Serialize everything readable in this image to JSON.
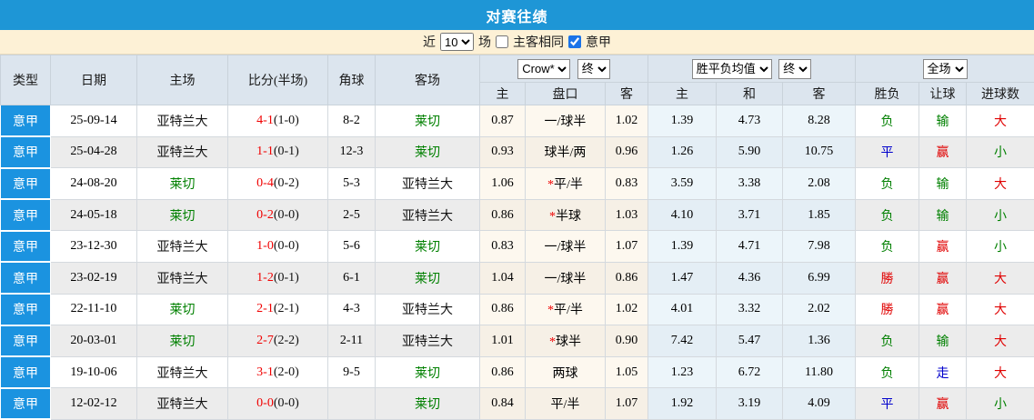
{
  "title": "对赛往绩",
  "colors": {
    "title_bar": "#1e96d6",
    "filter_bar": "#fdf1d6",
    "header_bg": "#dce5ee",
    "league_cell": "#1b93e0",
    "odds_col_bg": "#fdf8ef",
    "avg_col_bg": "#ecf5fa",
    "win_red": "#e00000",
    "lose_green": "#008000",
    "draw_blue": "#0000cc"
  },
  "filter": {
    "near_label": "近",
    "near_value": "10",
    "games_label": "场",
    "same_venue_label": "主客相同",
    "same_venue_checked": false,
    "league_label": "意甲",
    "league_checked": true
  },
  "table": {
    "selects": {
      "bookmaker": "Crow*",
      "bookmaker_time": "终",
      "avg": "胜平负均值",
      "avg_time": "终",
      "period": "全场"
    },
    "columns": {
      "type": "类型",
      "date": "日期",
      "home": "主场",
      "score": "比分(半场)",
      "corner": "角球",
      "away": "客场",
      "odds_home": "主",
      "handicap": "盘口",
      "odds_away": "客",
      "avg_home": "主",
      "avg_draw": "和",
      "avg_away": "客",
      "result": "胜负",
      "handicap_result": "让球",
      "goals": "进球数"
    },
    "rows": [
      {
        "type": "意甲",
        "date": "25-09-14",
        "home": "亚特兰大",
        "home_color": "black",
        "score": "4-1",
        "half": "(1-0)",
        "corner": "8-2",
        "away": "莱切",
        "away_color": "green",
        "odds_home": "0.87",
        "star": "",
        "handicap": "一/球半",
        "odds_away": "1.02",
        "avg_home": "1.39",
        "avg_draw": "4.73",
        "avg_away": "8.28",
        "result": "负",
        "result_color": "green",
        "handicap_result": "输",
        "handicap_result_color": "green",
        "goals": "大",
        "goals_color": "red"
      },
      {
        "type": "意甲",
        "date": "25-04-28",
        "home": "亚特兰大",
        "home_color": "black",
        "score": "1-1",
        "half": "(0-1)",
        "corner": "12-3",
        "away": "莱切",
        "away_color": "green",
        "odds_home": "0.93",
        "star": "",
        "handicap": "球半/两",
        "odds_away": "0.96",
        "avg_home": "1.26",
        "avg_draw": "5.90",
        "avg_away": "10.75",
        "result": "平",
        "result_color": "blue",
        "handicap_result": "赢",
        "handicap_result_color": "red",
        "goals": "小",
        "goals_color": "green"
      },
      {
        "type": "意甲",
        "date": "24-08-20",
        "home": "莱切",
        "home_color": "green",
        "score": "0-4",
        "half": "(0-2)",
        "corner": "5-3",
        "away": "亚特兰大",
        "away_color": "black",
        "odds_home": "1.06",
        "star": "*",
        "handicap": "平/半",
        "odds_away": "0.83",
        "avg_home": "3.59",
        "avg_draw": "3.38",
        "avg_away": "2.08",
        "result": "负",
        "result_color": "green",
        "handicap_result": "输",
        "handicap_result_color": "green",
        "goals": "大",
        "goals_color": "red"
      },
      {
        "type": "意甲",
        "date": "24-05-18",
        "home": "莱切",
        "home_color": "green",
        "score": "0-2",
        "half": "(0-0)",
        "corner": "2-5",
        "away": "亚特兰大",
        "away_color": "black",
        "odds_home": "0.86",
        "star": "*",
        "handicap": "半球",
        "odds_away": "1.03",
        "avg_home": "4.10",
        "avg_draw": "3.71",
        "avg_away": "1.85",
        "result": "负",
        "result_color": "green",
        "handicap_result": "输",
        "handicap_result_color": "green",
        "goals": "小",
        "goals_color": "green"
      },
      {
        "type": "意甲",
        "date": "23-12-30",
        "home": "亚特兰大",
        "home_color": "black",
        "score": "1-0",
        "half": "(0-0)",
        "corner": "5-6",
        "away": "莱切",
        "away_color": "green",
        "odds_home": "0.83",
        "star": "",
        "handicap": "一/球半",
        "odds_away": "1.07",
        "avg_home": "1.39",
        "avg_draw": "4.71",
        "avg_away": "7.98",
        "result": "负",
        "result_color": "green",
        "handicap_result": "赢",
        "handicap_result_color": "red",
        "goals": "小",
        "goals_color": "green"
      },
      {
        "type": "意甲",
        "date": "23-02-19",
        "home": "亚特兰大",
        "home_color": "black",
        "score": "1-2",
        "half": "(0-1)",
        "corner": "6-1",
        "away": "莱切",
        "away_color": "green",
        "odds_home": "1.04",
        "star": "",
        "handicap": "一/球半",
        "odds_away": "0.86",
        "avg_home": "1.47",
        "avg_draw": "4.36",
        "avg_away": "6.99",
        "result": "勝",
        "result_color": "red",
        "handicap_result": "赢",
        "handicap_result_color": "red",
        "goals": "大",
        "goals_color": "red"
      },
      {
        "type": "意甲",
        "date": "22-11-10",
        "home": "莱切",
        "home_color": "green",
        "score": "2-1",
        "half": "(2-1)",
        "corner": "4-3",
        "away": "亚特兰大",
        "away_color": "black",
        "odds_home": "0.86",
        "star": "*",
        "handicap": "平/半",
        "odds_away": "1.02",
        "avg_home": "4.01",
        "avg_draw": "3.32",
        "avg_away": "2.02",
        "result": "勝",
        "result_color": "red",
        "handicap_result": "赢",
        "handicap_result_color": "red",
        "goals": "大",
        "goals_color": "red"
      },
      {
        "type": "意甲",
        "date": "20-03-01",
        "home": "莱切",
        "home_color": "green",
        "score": "2-7",
        "half": "(2-2)",
        "corner": "2-11",
        "away": "亚特兰大",
        "away_color": "black",
        "odds_home": "1.01",
        "star": "*",
        "handicap": "球半",
        "odds_away": "0.90",
        "avg_home": "7.42",
        "avg_draw": "5.47",
        "avg_away": "1.36",
        "result": "负",
        "result_color": "green",
        "handicap_result": "输",
        "handicap_result_color": "green",
        "goals": "大",
        "goals_color": "red"
      },
      {
        "type": "意甲",
        "date": "19-10-06",
        "home": "亚特兰大",
        "home_color": "black",
        "score": "3-1",
        "half": "(2-0)",
        "corner": "9-5",
        "away": "莱切",
        "away_color": "green",
        "odds_home": "0.86",
        "star": "",
        "handicap": "两球",
        "odds_away": "1.05",
        "avg_home": "1.23",
        "avg_draw": "6.72",
        "avg_away": "11.80",
        "result": "负",
        "result_color": "green",
        "handicap_result": "走",
        "handicap_result_color": "blue",
        "goals": "大",
        "goals_color": "red"
      },
      {
        "type": "意甲",
        "date": "12-02-12",
        "home": "亚特兰大",
        "home_color": "black",
        "score": "0-0",
        "half": "(0-0)",
        "corner": "",
        "away": "莱切",
        "away_color": "green",
        "odds_home": "0.84",
        "star": "",
        "handicap": "平/半",
        "odds_away": "1.07",
        "avg_home": "1.92",
        "avg_draw": "3.19",
        "avg_away": "4.09",
        "result": "平",
        "result_color": "blue",
        "handicap_result": "赢",
        "handicap_result_color": "red",
        "goals": "小",
        "goals_color": "green"
      }
    ]
  }
}
